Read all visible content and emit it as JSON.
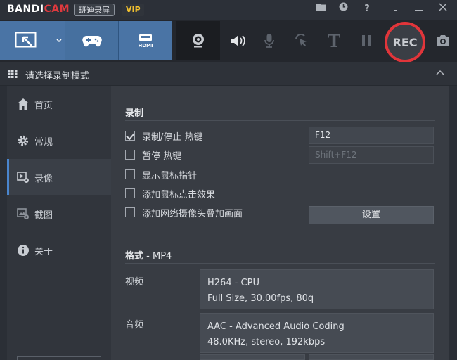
{
  "app": {
    "logo_white": "BANDI",
    "logo_red": "CAM",
    "name_cn": "班迪录屏",
    "vip": "VIP"
  },
  "toolbar": {
    "rec_label": "REC",
    "text_tool": "T"
  },
  "mode": {
    "title": "请选择录制模式"
  },
  "sidebar": {
    "items": [
      {
        "label": "首页",
        "icon": "home-icon"
      },
      {
        "label": "常规",
        "icon": "gear-icon"
      },
      {
        "label": "录像",
        "icon": "video-settings-icon"
      },
      {
        "label": "截图",
        "icon": "image-settings-icon"
      },
      {
        "label": "关于",
        "icon": "info-icon"
      }
    ],
    "active_index": 2
  },
  "record": {
    "section_title": "录制",
    "options": [
      {
        "label": "录制/停止 热键",
        "checked": true
      },
      {
        "label": "暂停 热键",
        "checked": false
      },
      {
        "label": "显示鼠标指针",
        "checked": false
      },
      {
        "label": "添加鼠标点击效果",
        "checked": false
      },
      {
        "label": "添加网络摄像头叠加画面",
        "checked": false
      }
    ],
    "hotkey_record": "F12",
    "hotkey_pause": "Shift+F12",
    "settings_button": "设置"
  },
  "format": {
    "title_prefix": "格式",
    "title_dash": " - ",
    "container": "MP4",
    "video_label": "视频",
    "video_codec": "H264 - CPU",
    "video_detail": "Full Size, 30.00fps, 80q",
    "audio_label": "音频",
    "audio_codec": "AAC - Advanced Audio Coding",
    "audio_detail": "48.0KHz, stereo, 192kbps"
  },
  "colors": {
    "accent_blue": "#4a74a5",
    "rec_red": "#e1353a",
    "vip_yellow": "#f2c12e"
  }
}
